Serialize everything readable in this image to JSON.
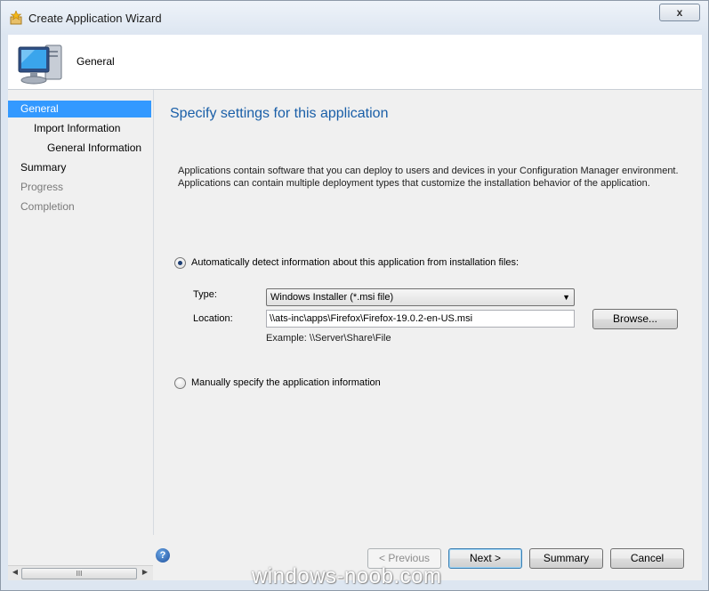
{
  "window": {
    "title": "Create Application Wizard",
    "close_label": "x"
  },
  "header": {
    "title": "General",
    "icon": "computer-monitor-icon"
  },
  "nav": {
    "items": [
      {
        "label": "General",
        "state": "selected"
      },
      {
        "label": "Import Information",
        "state": "normal"
      },
      {
        "label": "General Information",
        "state": "normal"
      },
      {
        "label": "Summary",
        "state": "normal"
      },
      {
        "label": "Progress",
        "state": "disabled"
      },
      {
        "label": "Completion",
        "state": "disabled"
      }
    ],
    "scroll_thumb_label": "III"
  },
  "content": {
    "heading": "Specify settings for this application",
    "description_line1": "Applications contain software that you can deploy to users and devices in your Configuration Manager environment.",
    "description_line2": "Applications can contain multiple deployment types that customize the installation behavior of the application.",
    "auto_detect_label": "Automatically detect information about this application from installation files:",
    "auto_detect_checked": true,
    "type_label": "Type:",
    "type_value": "Windows Installer (*.msi file)",
    "location_label": "Location:",
    "location_value": "\\\\ats-inc\\apps\\Firefox\\Firefox-19.0.2-en-US.msi",
    "browse_label": "Browse...",
    "example_text": "Example: \\\\Server\\Share\\File",
    "manual_label": "Manually specify the application information",
    "manual_checked": false
  },
  "footer": {
    "previous_label": "< Previous",
    "next_label": "Next >",
    "summary_label": "Summary",
    "cancel_label": "Cancel",
    "help_label": "?"
  },
  "watermark": "windows-noob.com",
  "colors": {
    "selected_bg": "#3399ff",
    "heading": "#1a5fa8",
    "window_bg": "#f0f0f0"
  }
}
